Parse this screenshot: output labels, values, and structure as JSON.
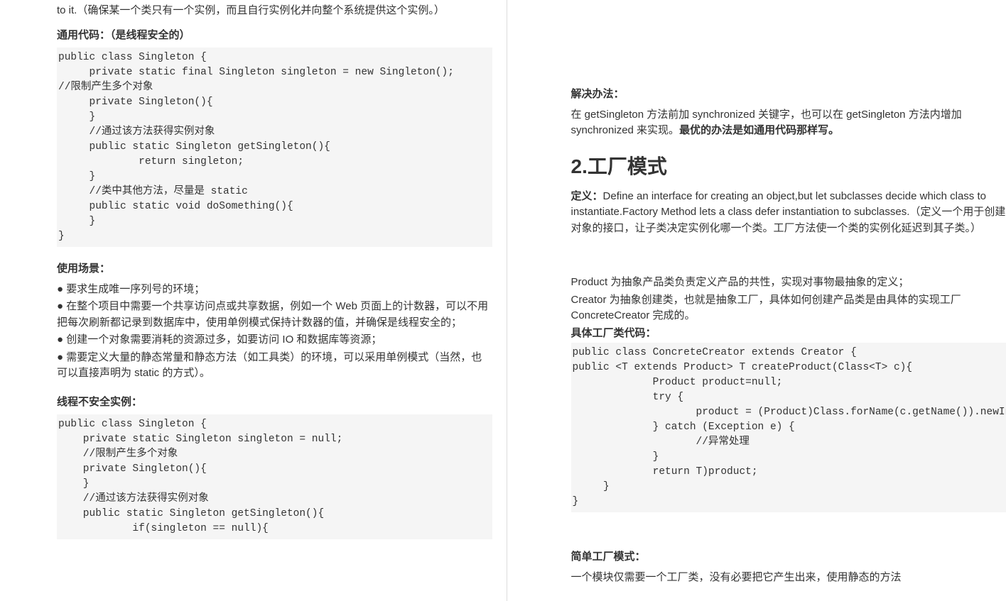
{
  "left": {
    "intro_fragment": "to it.（确保某一个类只有一个实例，而且自行实例化并向整个系统提供这个实例。）",
    "generic_code_label": "通用代码：（是线程安全的）",
    "code1": "public class Singleton {\n     private static final Singleton singleton = new Singleton();\n//限制产生多个对象\n     private Singleton(){\n     }\n     //通过该方法获得实例对象\n     public static Singleton getSingleton(){\n             return singleton;\n     }\n     //类中其他方法，尽量是 static\n     public static void doSomething(){\n     }\n}",
    "usage_label": "使用场景：",
    "bullets": [
      "● 要求生成唯一序列号的环境；",
      "● 在整个项目中需要一个共享访问点或共享数据，例如一个 Web 页面上的计数器，可以不用把每次刷新都记录到数据库中，使用单例模式保持计数器的值，并确保是线程安全的；",
      "● 创建一个对象需要消耗的资源过多，如要访问 IO 和数据库等资源；",
      "● 需要定义大量的静态常量和静态方法（如工具类）的环境，可以采用单例模式（当然，也可以直接声明为 static 的方式）。"
    ],
    "unsafe_label": "线程不安全实例：",
    "code2": "public class Singleton {\n    private static Singleton singleton = null;\n    //限制产生多个对象\n    private Singleton(){\n    }\n    //通过该方法获得实例对象\n    public static Singleton getSingleton(){\n            if(singleton == null){"
  },
  "right": {
    "solution_label": "解决办法：",
    "solution_body_a": "在 getSingleton 方法前加 synchronized 关键字，也可以在 getSingleton 方法内增加 synchronized 来实现。",
    "solution_body_b": "最优的办法是如通用代码那样写。",
    "h2": "2.工厂模式",
    "def_label": "定义：",
    "def_body": "Define an interface for creating an object,but let subclasses decide which class to instantiate.Factory Method lets a class defer instantiation to subclasses.（定义一个用于创建对象的接口，让子类决定实例化哪一个类。工厂方法使一个类的实例化延迟到其子类。）",
    "roles": [
      "Product 为抽象产品类负责定义产品的共性，实现对事物最抽象的定义；",
      "Creator 为抽象创建类，也就是抽象工厂，具体如何创建产品类是由具体的实现工厂 ConcreteCreator 完成的。"
    ],
    "concrete_label": "具体工厂类代码：",
    "code1": "public class ConcreteCreator extends Creator {\npublic <T extends Product> T createProduct(Class<T> c){\n             Product product=null;\n             try {\n                    product = (Product)Class.forName(c.getName()).newInstance();\n             } catch (Exception e) {\n                    //异常处理\n             }\n             return T)product;\n     }\n}",
    "simple_label": "简单工厂模式：",
    "simple_body": "一个模块仅需要一个工厂类，没有必要把它产生出来，使用静态的方法"
  }
}
